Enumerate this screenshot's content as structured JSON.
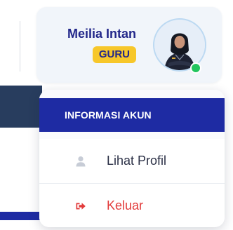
{
  "user": {
    "name": "Meilia Intan",
    "role": "GURU",
    "status": "online"
  },
  "menu": {
    "header": "INFORMASI AKUN",
    "items": [
      {
        "label": "Lihat Profil",
        "icon": "user-icon"
      },
      {
        "label": "Keluar",
        "icon": "sign-out-icon"
      }
    ]
  },
  "colors": {
    "primary": "#1e2ba3",
    "name_text": "#22278a",
    "badge": "#f7c72a",
    "logout": "#e23b3b",
    "online": "#22c55e",
    "card_bg": "#f1f5fa"
  }
}
